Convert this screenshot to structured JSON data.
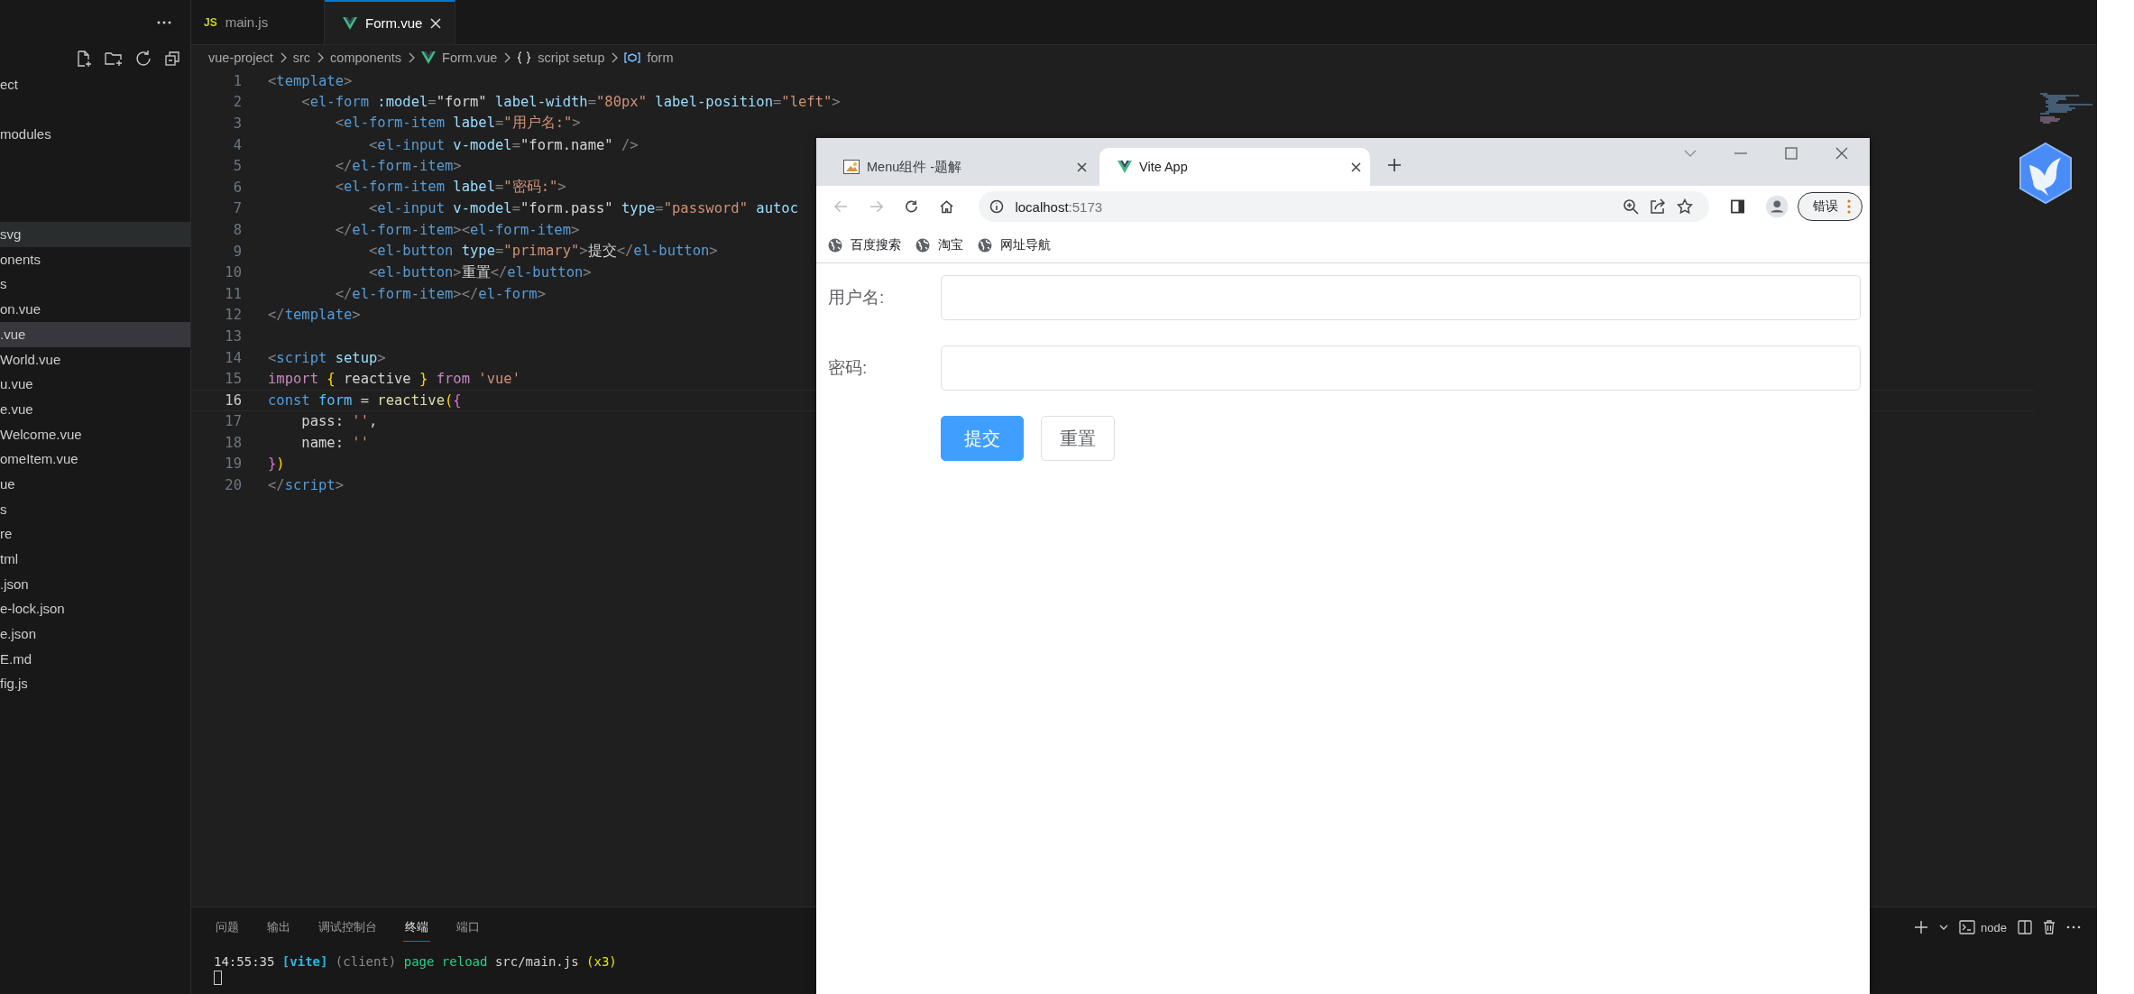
{
  "sidebar": {
    "items": [
      {
        "label": "ect",
        "selected": false,
        "hovered": false
      },
      {
        "label": "modules",
        "selected": false,
        "hovered": false
      },
      {
        "label": "svg",
        "selected": false,
        "hovered": true
      },
      {
        "label": "onents",
        "selected": false,
        "hovered": false
      },
      {
        "label": "s",
        "selected": false,
        "hovered": false
      },
      {
        "label": "on.vue",
        "selected": false,
        "hovered": false
      },
      {
        "label": ".vue",
        "selected": true,
        "hovered": false
      },
      {
        "label": "World.vue",
        "selected": false,
        "hovered": false
      },
      {
        "label": "u.vue",
        "selected": false,
        "hovered": false
      },
      {
        "label": "e.vue",
        "selected": false,
        "hovered": false
      },
      {
        "label": "Welcome.vue",
        "selected": false,
        "hovered": false
      },
      {
        "label": "omeItem.vue",
        "selected": false,
        "hovered": false
      },
      {
        "label": "ue",
        "selected": false,
        "hovered": false
      },
      {
        "label": "s",
        "selected": false,
        "hovered": false
      },
      {
        "label": "re",
        "selected": false,
        "hovered": false
      },
      {
        "label": "tml",
        "selected": false,
        "hovered": false
      },
      {
        "label": ".json",
        "selected": false,
        "hovered": false
      },
      {
        "label": "e-lock.json",
        "selected": false,
        "hovered": false
      },
      {
        "label": "e.json",
        "selected": false,
        "hovered": false
      },
      {
        "label": "E.md",
        "selected": false,
        "hovered": false
      },
      {
        "label": "fig.js",
        "selected": false,
        "hovered": false
      }
    ]
  },
  "editor": {
    "tabs": [
      {
        "label": "main.js",
        "kind": "js",
        "badge": "JS",
        "selected": false
      },
      {
        "label": "Form.vue",
        "kind": "vue",
        "selected": true
      }
    ],
    "breadcrumbs": [
      {
        "label": "vue-project"
      },
      {
        "label": "src"
      },
      {
        "label": "components"
      },
      {
        "label": "Form.vue",
        "kind": "vue"
      },
      {
        "label": "script setup",
        "kind": "braces"
      },
      {
        "label": "form",
        "kind": "field"
      }
    ],
    "lines": [
      {
        "n": "1",
        "current": false,
        "t": [
          {
            "kind": "p",
            "text": "<"
          },
          {
            "kind": "tag",
            "text": "template"
          },
          {
            "kind": "p",
            "text": ">"
          }
        ]
      },
      {
        "n": "2",
        "current": false,
        "t": [
          {
            "kind": "p",
            "text": "    <"
          },
          {
            "kind": "tag",
            "text": "el-form"
          },
          {
            "kind": "attr",
            "text": " :model"
          },
          {
            "kind": "p",
            "text": "="
          },
          {
            "kind": "val",
            "text": "\"form\""
          },
          {
            "kind": "attr",
            "text": " label-width"
          },
          {
            "kind": "p",
            "text": "="
          },
          {
            "kind": "str",
            "text": "\"80px\""
          },
          {
            "kind": "attr",
            "text": " label-position"
          },
          {
            "kind": "p",
            "text": "="
          },
          {
            "kind": "str",
            "text": "\"left\""
          },
          {
            "kind": "p",
            "text": ">"
          }
        ]
      },
      {
        "n": "3",
        "current": false,
        "t": [
          {
            "kind": "p",
            "text": "        <"
          },
          {
            "kind": "tag",
            "text": "el-form-item"
          },
          {
            "kind": "attr",
            "text": " label"
          },
          {
            "kind": "p",
            "text": "="
          },
          {
            "kind": "str",
            "text": "\"用户名:\""
          },
          {
            "kind": "p",
            "text": ">"
          }
        ]
      },
      {
        "n": "4",
        "current": false,
        "t": [
          {
            "kind": "p",
            "text": "            <"
          },
          {
            "kind": "tag",
            "text": "el-input"
          },
          {
            "kind": "attr",
            "text": " v-model"
          },
          {
            "kind": "p",
            "text": "="
          },
          {
            "kind": "val",
            "text": "\"form.name\""
          },
          {
            "kind": "p",
            "text": " />"
          }
        ]
      },
      {
        "n": "5",
        "current": false,
        "t": [
          {
            "kind": "p",
            "text": "        </"
          },
          {
            "kind": "tag",
            "text": "el-form-item"
          },
          {
            "kind": "p",
            "text": ">"
          }
        ]
      },
      {
        "n": "6",
        "current": false,
        "t": [
          {
            "kind": "p",
            "text": "        <"
          },
          {
            "kind": "tag",
            "text": "el-form-item"
          },
          {
            "kind": "attr",
            "text": " label"
          },
          {
            "kind": "p",
            "text": "="
          },
          {
            "kind": "str",
            "text": "\"密码:\""
          },
          {
            "kind": "p",
            "text": ">"
          }
        ]
      },
      {
        "n": "7",
        "current": false,
        "t": [
          {
            "kind": "p",
            "text": "            <"
          },
          {
            "kind": "tag",
            "text": "el-input"
          },
          {
            "kind": "attr",
            "text": " v-model"
          },
          {
            "kind": "p",
            "text": "="
          },
          {
            "kind": "val",
            "text": "\"form.pass\""
          },
          {
            "kind": "attr",
            "text": " type"
          },
          {
            "kind": "p",
            "text": "="
          },
          {
            "kind": "str",
            "text": "\"password\""
          },
          {
            "kind": "attr",
            "text": " autoc"
          }
        ]
      },
      {
        "n": "8",
        "current": false,
        "t": [
          {
            "kind": "p",
            "text": "        </"
          },
          {
            "kind": "tag",
            "text": "el-form-item"
          },
          {
            "kind": "p",
            "text": "><"
          },
          {
            "kind": "tag",
            "text": "el-form-item"
          },
          {
            "kind": "p",
            "text": ">"
          }
        ]
      },
      {
        "n": "9",
        "current": false,
        "t": [
          {
            "kind": "p",
            "text": "            <"
          },
          {
            "kind": "tag",
            "text": "el-button"
          },
          {
            "kind": "attr",
            "text": " type"
          },
          {
            "kind": "p",
            "text": "="
          },
          {
            "kind": "str",
            "text": "\"primary\""
          },
          {
            "kind": "p",
            "text": ">"
          },
          {
            "kind": "txt",
            "text": "提交"
          },
          {
            "kind": "p",
            "text": "</"
          },
          {
            "kind": "tag",
            "text": "el-button"
          },
          {
            "kind": "p",
            "text": ">"
          }
        ]
      },
      {
        "n": "10",
        "current": false,
        "t": [
          {
            "kind": "p",
            "text": "            <"
          },
          {
            "kind": "tag",
            "text": "el-button"
          },
          {
            "kind": "p",
            "text": ">"
          },
          {
            "kind": "txt",
            "text": "重置"
          },
          {
            "kind": "p",
            "text": "</"
          },
          {
            "kind": "tag",
            "text": "el-button"
          },
          {
            "kind": "p",
            "text": ">"
          }
        ]
      },
      {
        "n": "11",
        "current": false,
        "t": [
          {
            "kind": "p",
            "text": "        </"
          },
          {
            "kind": "tag",
            "text": "el-form-item"
          },
          {
            "kind": "p",
            "text": "></"
          },
          {
            "kind": "tag",
            "text": "el-form"
          },
          {
            "kind": "p",
            "text": ">"
          }
        ]
      },
      {
        "n": "12",
        "current": false,
        "t": [
          {
            "kind": "p",
            "text": "</"
          },
          {
            "kind": "tag",
            "text": "template"
          },
          {
            "kind": "p",
            "text": ">"
          }
        ]
      },
      {
        "n": "13",
        "current": false
      },
      {
        "n": "14",
        "current": false,
        "t": [
          {
            "kind": "p",
            "text": "<"
          },
          {
            "kind": "tag",
            "text": "script"
          },
          {
            "kind": "attr",
            "text": " setup"
          },
          {
            "kind": "p",
            "text": ">"
          }
        ]
      },
      {
        "n": "15",
        "current": false,
        "t": [
          {
            "kind": "kw",
            "text": "import"
          },
          {
            "kind": "b1",
            "text": " {"
          },
          {
            "kind": "txt",
            "text": " reactive "
          },
          {
            "kind": "b1",
            "text": "}"
          },
          {
            "kind": "kw",
            "text": " from"
          },
          {
            "kind": "str",
            "text": " 'vue'"
          }
        ]
      },
      {
        "n": "16",
        "current": true,
        "t": [
          {
            "kind": "decl",
            "text": "const"
          },
          {
            "kind": "var",
            "text": " form"
          },
          {
            "kind": "txt",
            "text": " = "
          },
          {
            "kind": "fn",
            "text": "reactive"
          },
          {
            "kind": "b1",
            "text": "("
          },
          {
            "kind": "b2",
            "text": "{"
          }
        ]
      },
      {
        "n": "17",
        "current": false,
        "t": [
          {
            "kind": "txt",
            "text": "    pass: "
          },
          {
            "kind": "str",
            "text": "''"
          },
          {
            "kind": "txt",
            "text": ","
          }
        ]
      },
      {
        "n": "18",
        "current": false,
        "t": [
          {
            "kind": "txt",
            "text": "    name: "
          },
          {
            "kind": "str",
            "text": "''"
          }
        ]
      },
      {
        "n": "19",
        "current": false,
        "t": [
          {
            "kind": "b2",
            "text": "}"
          },
          {
            "kind": "b1",
            "text": ")"
          }
        ]
      },
      {
        "n": "20",
        "current": false,
        "t": [
          {
            "kind": "p",
            "text": "</"
          },
          {
            "kind": "tag",
            "text": "script"
          },
          {
            "kind": "p",
            "text": ">"
          }
        ]
      }
    ]
  },
  "panel": {
    "tabs": [
      {
        "label": "问题",
        "selected": false
      },
      {
        "label": "输出",
        "selected": false
      },
      {
        "label": "调试控制台",
        "selected": false
      },
      {
        "label": "终端",
        "selected": true
      },
      {
        "label": "端口",
        "selected": false
      }
    ],
    "terminal": [
      {
        "kind": "txt",
        "text": "14:55:35 "
      },
      {
        "kind": "vite",
        "text": "[vite]"
      },
      {
        "kind": "dim",
        "text": " (client)"
      },
      {
        "kind": "ok",
        "text": " page reload"
      },
      {
        "kind": "txt",
        "text": " src/main.js"
      },
      {
        "kind": "warn",
        "text": " (x3)"
      }
    ],
    "shell": "node"
  },
  "browser": {
    "tabs": [
      {
        "title": "Menu组件 -题解",
        "kind": "image",
        "selected": false
      },
      {
        "title": "Vite App",
        "kind": "vue",
        "selected": true
      }
    ],
    "address": {
      "host": "localhost",
      "port": ":5173"
    },
    "profile_button": "错误",
    "bookmarks": [
      "百度搜索",
      "淘宝",
      "网址导航"
    ],
    "form": {
      "fields": [
        {
          "label": "用户名:"
        },
        {
          "label": "密码:"
        }
      ],
      "buttons": [
        {
          "label": "提交",
          "kind": "primary"
        },
        {
          "label": "重置",
          "kind": "default"
        }
      ]
    }
  }
}
